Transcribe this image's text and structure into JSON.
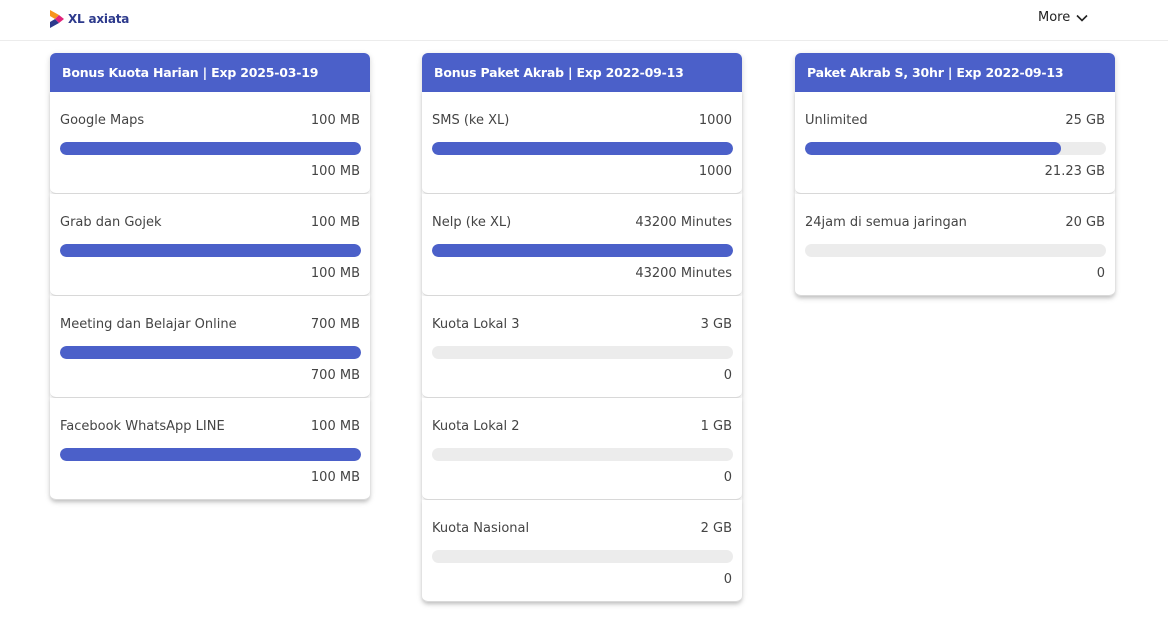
{
  "header": {
    "brand": "XL axiata",
    "more_label": "More",
    "brand_colors": {
      "primary": "#2d3a8c",
      "accent_orange": "#f7941d",
      "accent_magenta": "#e2237a"
    }
  },
  "accent_color": "#4b60c9",
  "cards": [
    {
      "title": "Bonus Kuota Harian | Exp 2025-03-19",
      "items": [
        {
          "name": "Google Maps",
          "total": "100 MB",
          "remaining": "100 MB",
          "fraction": 1.0
        },
        {
          "name": "Grab dan Gojek",
          "total": "100 MB",
          "remaining": "100 MB",
          "fraction": 1.0
        },
        {
          "name": "Meeting dan Belajar Online",
          "total": "700 MB",
          "remaining": "700 MB",
          "fraction": 1.0
        },
        {
          "name": "Facebook WhatsApp LINE",
          "total": "100 MB",
          "remaining": "100 MB",
          "fraction": 1.0
        }
      ]
    },
    {
      "title": "Bonus Paket Akrab | Exp 2022-09-13",
      "items": [
        {
          "name": "SMS (ke XL)",
          "total": "1000",
          "remaining": "1000",
          "fraction": 1.0
        },
        {
          "name": "Nelp (ke XL)",
          "total": "43200 Minutes",
          "remaining": "43200 Minutes",
          "fraction": 1.0
        },
        {
          "name": "Kuota Lokal 3",
          "total": "3 GB",
          "remaining": "0",
          "fraction": 0.0
        },
        {
          "name": "Kuota Lokal 2",
          "total": "1 GB",
          "remaining": "0",
          "fraction": 0.0
        },
        {
          "name": "Kuota Nasional",
          "total": "2 GB",
          "remaining": "0",
          "fraction": 0.0
        }
      ]
    },
    {
      "title": "Paket Akrab S, 30hr | Exp 2022-09-13",
      "items": [
        {
          "name": "Unlimited",
          "total": "25 GB",
          "remaining": "21.23 GB",
          "fraction": 0.8492
        },
        {
          "name": "24jam di semua jaringan",
          "total": "20 GB",
          "remaining": "0",
          "fraction": 0.0
        }
      ]
    }
  ]
}
